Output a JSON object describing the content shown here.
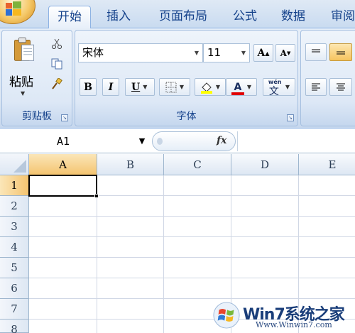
{
  "tabs": [
    {
      "label": "开始",
      "active": true
    },
    {
      "label": "插入",
      "active": false
    },
    {
      "label": "页面布局",
      "active": false
    },
    {
      "label": "公式",
      "active": false
    },
    {
      "label": "数据",
      "active": false
    },
    {
      "label": "审阅",
      "active": false
    }
  ],
  "clipboard": {
    "paste_label": "粘贴",
    "group_label": "剪贴板"
  },
  "font": {
    "font_name": "宋体",
    "font_size": "11",
    "group_label": "字体",
    "bold": "B",
    "italic": "I",
    "underline": "U",
    "phonetic_label": "wén",
    "phonetic_char": "文",
    "grow_label": "A",
    "shrink_label": "A",
    "font_color_label": "A"
  },
  "formula_bar": {
    "name_box": "A1",
    "fx_label": "fx",
    "value": ""
  },
  "grid": {
    "columns": [
      "A",
      "B",
      "C",
      "D",
      "E"
    ],
    "rows": [
      "1",
      "2",
      "3",
      "4",
      "5",
      "6",
      "7",
      "8"
    ],
    "selected_cell": "A1"
  },
  "colors": {
    "highlight": "#ffff00",
    "font_color": "#e00000",
    "accent": "#15428b"
  },
  "watermark": {
    "title": "Win7系统之家",
    "url": "Www.Winwin7.com"
  }
}
